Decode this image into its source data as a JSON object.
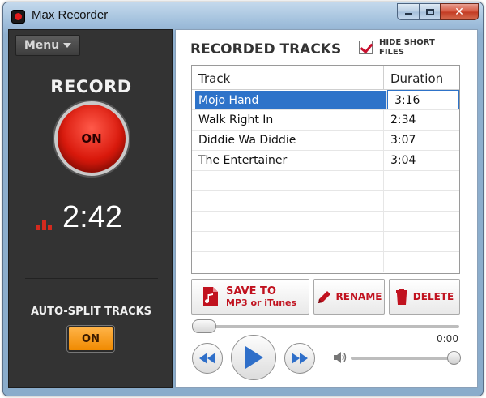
{
  "window": {
    "title": "Max Recorder",
    "accent": "#c1121f",
    "record_color": "#d9190c",
    "toggle_color": "#f08a00"
  },
  "left_panel": {
    "menu_label": "Menu",
    "record_label": "RECORD",
    "record_state": "ON",
    "timer": "2:42",
    "auto_split_label": "AUTO-SPLIT TRACKS",
    "auto_split_state": "ON"
  },
  "right_panel": {
    "title": "RECORDED TRACKS",
    "hide_short_files_label": "HIDE SHORT FILES",
    "hide_short_files_checked": true,
    "columns": [
      "Track",
      "Duration"
    ],
    "tracks": [
      {
        "name": "Mojo Hand",
        "duration": "3:16",
        "selected": true
      },
      {
        "name": "Walk Right In",
        "duration": "2:34",
        "selected": false
      },
      {
        "name": "Diddie Wa Diddie",
        "duration": "3:07",
        "selected": false
      },
      {
        "name": "The Entertainer",
        "duration": "3:04",
        "selected": false
      }
    ],
    "save_line1": "SAVE TO",
    "save_line2": "MP3 or iTunes",
    "rename_label": "RENAME",
    "delete_label": "DELETE",
    "elapsed": "0:00",
    "playback_progress": 0.0,
    "volume_level": 1.0
  }
}
